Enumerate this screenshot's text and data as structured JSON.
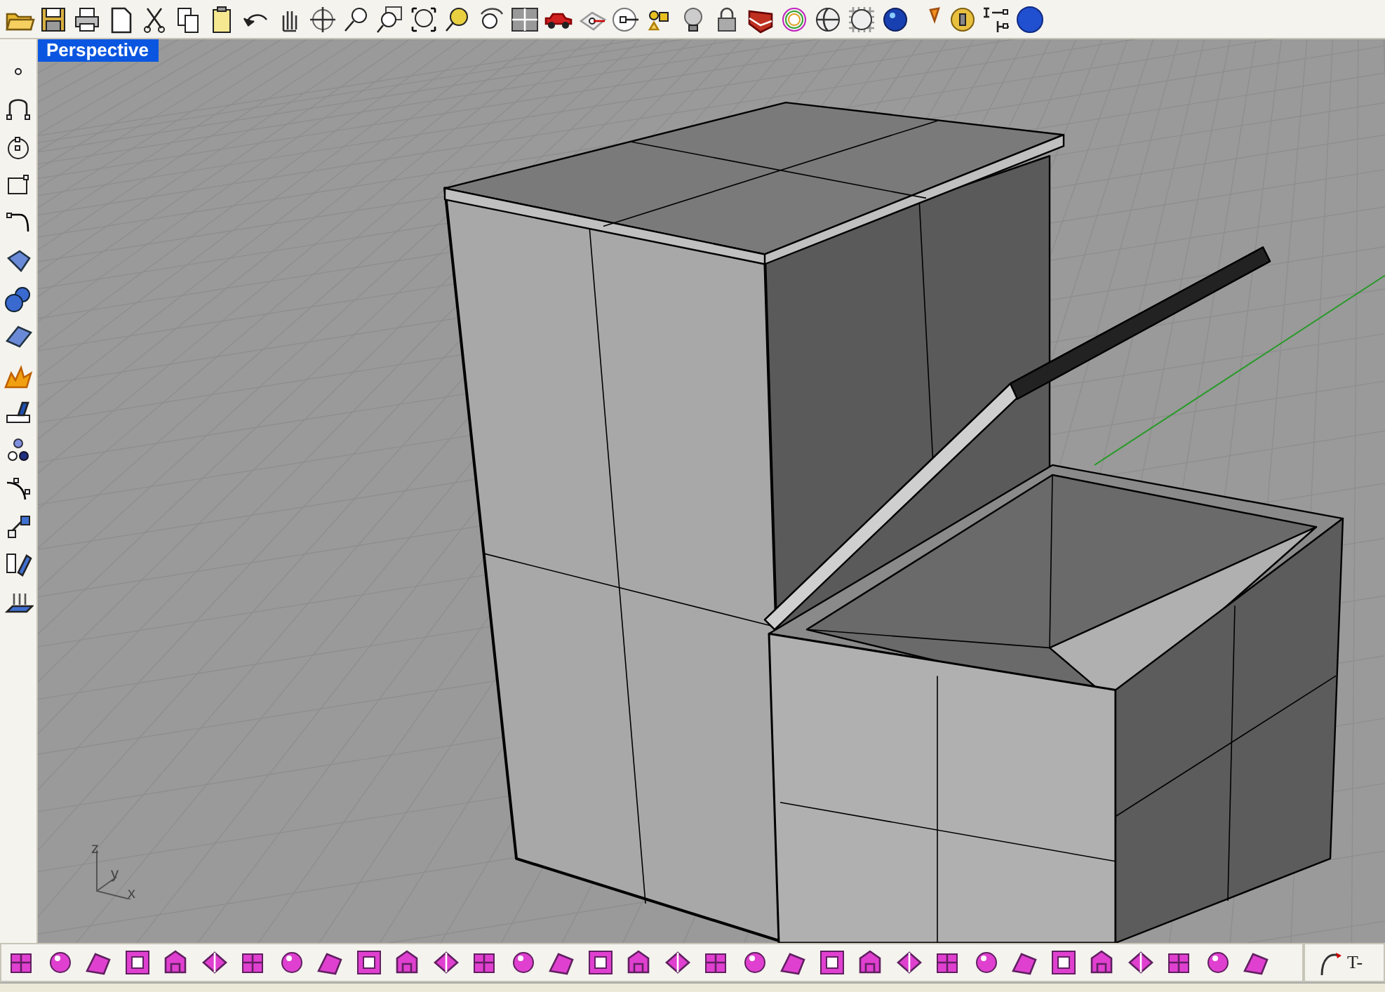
{
  "viewport": {
    "title": "Perspective",
    "axes": [
      "z",
      "y",
      "x"
    ]
  },
  "command_toolbar": {
    "label": "T-"
  }
}
